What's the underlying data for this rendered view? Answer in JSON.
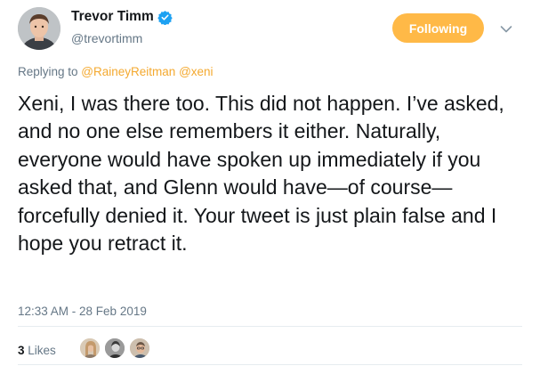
{
  "author": {
    "display_name": "Trevor Timm",
    "handle": "@trevortimm",
    "verified": true,
    "avatar_icon": "user-avatar"
  },
  "follow_button": {
    "label": "Following",
    "color": "#ffb947"
  },
  "menu": {
    "icon": "chevron-down-icon"
  },
  "reply": {
    "prefix": "Replying to ",
    "mention_1": "@RaineyReitman",
    "mention_2": "@xeni"
  },
  "tweet": {
    "text": "Xeni, I was there too. This did not happen. I’ve asked, and no one else remembers it either. Naturally, everyone would have spoken up immediately if you asked that, and Glenn would have—of course—forcefully denied it. Your tweet is just plain false and I hope you retract it.",
    "timestamp": "12:33 AM - 28 Feb 2019"
  },
  "stats": {
    "likes_count": "3",
    "likes_label": "Likes",
    "liker_avatars": [
      "liker-avatar-1",
      "liker-avatar-2",
      "liker-avatar-3"
    ]
  },
  "colors": {
    "accent": "#ffb947",
    "mention": "#f4a92f",
    "verified_badge": "#1da1f2",
    "secondary_text": "#657786"
  }
}
